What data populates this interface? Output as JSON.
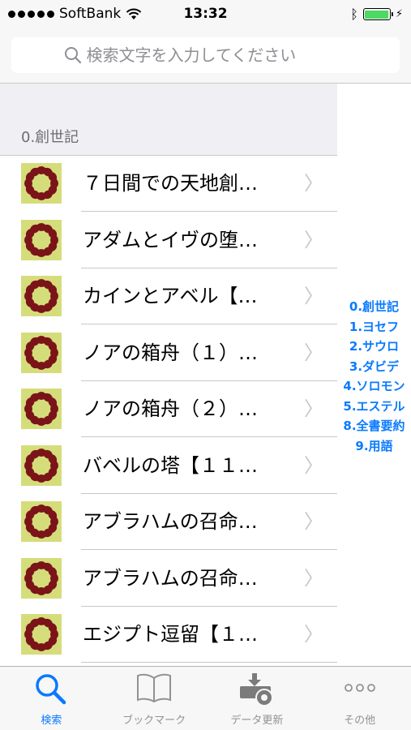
{
  "status_bar": {
    "carrier": "SoftBank",
    "time": "13:32"
  },
  "search": {
    "placeholder": "検索文字を入力してください"
  },
  "section": {
    "header": "0.創世記"
  },
  "rows": [
    {
      "title": "７日間での天地創…"
    },
    {
      "title": "アダムとイヴの堕…"
    },
    {
      "title": "カインとアベル【…"
    },
    {
      "title": "ノアの箱舟（１）…"
    },
    {
      "title": "ノアの箱舟（２）…"
    },
    {
      "title": "バベルの塔【１１…"
    },
    {
      "title": "アブラハムの召命…"
    },
    {
      "title": "アブラハムの召命…"
    },
    {
      "title": "エジプト逗留【１…"
    }
  ],
  "index": [
    "0.創世記",
    "1.ヨセフ",
    "2.サウロ",
    "3.ダビデ",
    "4.ソロモン",
    "5.エステル",
    "8.全書要約",
    "9.用語"
  ],
  "tabbar": {
    "search": "検索",
    "bookmarks": "ブックマーク",
    "update": "データ更新",
    "other": "その他"
  },
  "colors": {
    "accent": "#0a7aff",
    "battery": "#4cd964",
    "thumb_bg": "#d5dd7b",
    "thumb_ring": "#7a1418"
  }
}
